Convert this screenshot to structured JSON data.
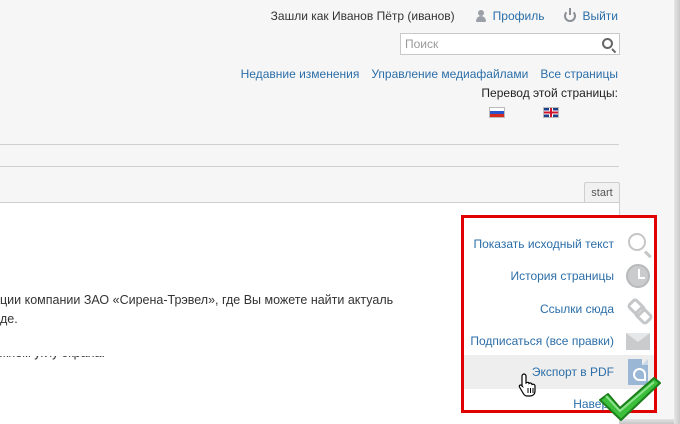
{
  "header": {
    "logged_in_text": "Зашли как Иванов Пётр (иванов)",
    "profile_link": "Профиль",
    "logout_link": "Выйти"
  },
  "search": {
    "placeholder": "Поиск"
  },
  "tools": {
    "recent_changes": "Недавние изменения",
    "media_manager": "Управление медиафайлами",
    "all_pages": "Все страницы"
  },
  "translation": {
    "label": "Перевод этой страницы:",
    "flags": [
      "flag-ru",
      "flag-en"
    ]
  },
  "page_tab": {
    "label": "start"
  },
  "content": {
    "line1": "ции компании ЗАО «Сирена-Трэвел», где Вы можете найти актуаль",
    "line2": "де.",
    "line3": "жнем углу экрана:"
  },
  "pagetools": {
    "items": [
      {
        "label": "Показать исходный текст",
        "icon": "magnifier-icon"
      },
      {
        "label": "История страницы",
        "icon": "clock-icon"
      },
      {
        "label": "Ссылки сюда",
        "icon": "link-icon"
      },
      {
        "label": "Подписаться (все правки)",
        "icon": "mail-icon"
      },
      {
        "label": "Экспорт в PDF",
        "icon": "pdf-icon"
      },
      {
        "label": "Наверх",
        "icon": "arrow-up-icon"
      }
    ],
    "highlight_color": "#e00000",
    "hovered_index": 4
  },
  "colors": {
    "link": "#2b6ea8",
    "check": "#2fb52f"
  }
}
